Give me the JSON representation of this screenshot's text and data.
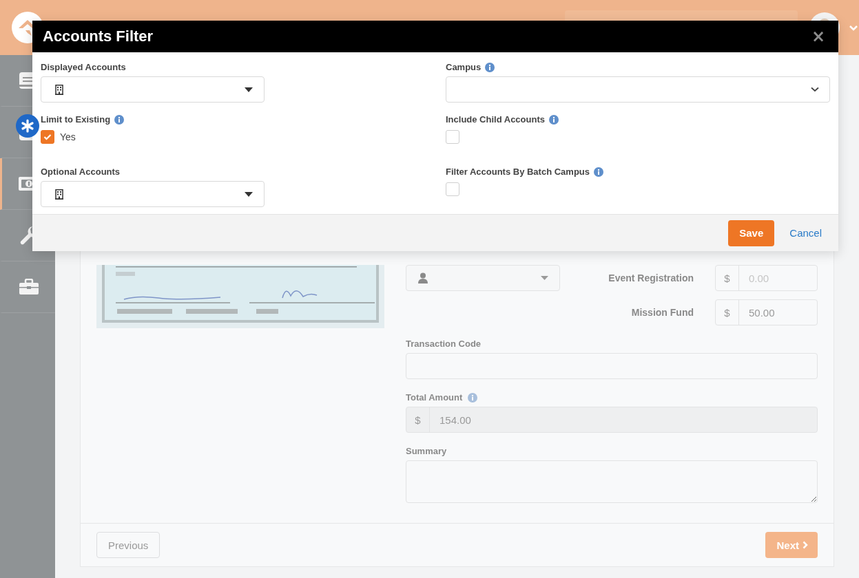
{
  "sidebar": {
    "items": [
      {
        "selected": false
      },
      {
        "selected": false
      },
      {
        "selected": true
      },
      {
        "selected": false
      },
      {
        "selected": false
      }
    ]
  },
  "form": {
    "accounts": [
      {
        "label": "Event Registration",
        "prefix": "$",
        "placeholder": "0.00"
      },
      {
        "label": "Mission Fund",
        "prefix": "$",
        "value": "50.00"
      }
    ],
    "transaction_code": {
      "label": "Transaction Code"
    },
    "total_amount": {
      "label": "Total Amount",
      "info": true,
      "prefix": "$",
      "value": "154.00"
    },
    "summary": {
      "label": "Summary"
    },
    "buttons": {
      "previous": "Previous",
      "next": "Next"
    }
  },
  "modal": {
    "title": "Accounts Filter",
    "close": "×",
    "fields": [
      {
        "kind": "account-picker",
        "label": "Displayed Accounts",
        "info": false
      },
      {
        "kind": "select",
        "label": "Campus",
        "info": true
      },
      {
        "kind": "checkbox",
        "label": "Limit to Existing",
        "info": true,
        "checked": true,
        "option": "Yes"
      },
      {
        "kind": "checkbox",
        "label": "Include Child Accounts",
        "info": true,
        "checked": false
      },
      {
        "kind": "account-picker",
        "label": "Optional Accounts",
        "info": false
      },
      {
        "kind": "checkbox",
        "label": "Filter Accounts By Batch Campus",
        "info": true,
        "checked": false
      }
    ],
    "save": "Save",
    "cancel": "Cancel"
  }
}
